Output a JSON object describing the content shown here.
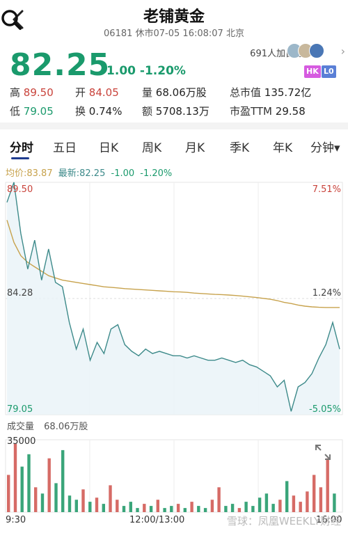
{
  "header": {
    "title": "老铺黄金",
    "subtitle": "06181 休市07-05 16:08:07 北京"
  },
  "quote": {
    "price": "82.25",
    "change": "-1.00 -1.20%",
    "watchers": "691人加自选",
    "tags": [
      "HK",
      "L0"
    ],
    "colors": {
      "down": "#1a9a6c",
      "up": "#c9433b",
      "hk": "#d65be0",
      "lo": "#5a7fd6"
    }
  },
  "stats": {
    "high_label": "高",
    "high": "89.50",
    "open_label": "开",
    "open": "84.05",
    "volume_label": "量",
    "volume": "68.06万股",
    "mcap_label": "总市值",
    "mcap": "135.72亿",
    "low_label": "低",
    "low": "79.05",
    "turnover_label": "换",
    "turnover": "0.74%",
    "amount_label": "额",
    "amount": "5708.13万",
    "pe_label": "市盈TTM",
    "pe": "29.58"
  },
  "tabs": [
    "分时",
    "五日",
    "日K",
    "周K",
    "月K",
    "季K",
    "年K",
    "分钟▾"
  ],
  "legend": {
    "avg": "均价:83.87",
    "latest": "最新:82.25",
    "chg": "-1.00",
    "pct": "-1.20%"
  },
  "chart_data": {
    "type": "line",
    "y_left_ticks": [
      "89.50",
      "84.28",
      "79.05"
    ],
    "y_right_ticks": [
      "7.51%",
      "1.24%",
      "-5.05%"
    ],
    "ylim": [
      79.05,
      89.5
    ],
    "x_ticks": [
      "9:30",
      "12:00/13:00",
      "16:00"
    ],
    "series": [
      {
        "name": "price",
        "color": "#3d8a8a",
        "values": [
          88.6,
          89.5,
          87.2,
          85.6,
          86.9,
          85.1,
          86.5,
          85.0,
          84.8,
          83.2,
          82.0,
          82.9,
          81.5,
          82.3,
          81.8,
          82.9,
          83.1,
          82.2,
          81.9,
          81.7,
          82.0,
          81.8,
          81.9,
          81.8,
          81.7,
          81.7,
          81.6,
          81.7,
          81.6,
          81.5,
          81.5,
          81.6,
          81.5,
          81.4,
          81.5,
          81.3,
          81.2,
          81.0,
          80.8,
          80.3,
          80.6,
          79.2,
          80.3,
          80.5,
          80.9,
          81.6,
          82.2,
          83.2,
          82.0
        ]
      },
      {
        "name": "avg",
        "color": "#c7a24c",
        "values": [
          87.8,
          86.8,
          86.2,
          85.9,
          85.7,
          85.5,
          85.3,
          85.2,
          85.1,
          85.05,
          85.0,
          84.95,
          84.9,
          84.85,
          84.8,
          84.78,
          84.75,
          84.72,
          84.7,
          84.68,
          84.66,
          84.64,
          84.62,
          84.6,
          84.58,
          84.57,
          84.55,
          84.52,
          84.5,
          84.48,
          84.46,
          84.45,
          84.43,
          84.41,
          84.38,
          84.35,
          84.32,
          84.28,
          84.24,
          84.18,
          84.1,
          84.05,
          83.98,
          83.93,
          83.9,
          83.88,
          83.87,
          83.87,
          83.87
        ]
      }
    ],
    "volume_label": "成交量",
    "volume_value": "68.06万股",
    "volume_max_tick": "35000",
    "volume_ylim": [
      0,
      35000
    ],
    "volumes": [
      18000,
      33000,
      22000,
      28000,
      12000,
      9000,
      26000,
      14000,
      30000,
      8000,
      6000,
      11000,
      5000,
      7000,
      4000,
      13000,
      6000,
      3000,
      5000,
      2000,
      4000,
      3000,
      6000,
      2000,
      3000,
      4000,
      2000,
      5000,
      3000,
      2000,
      6000,
      12000,
      3000,
      4000,
      2000,
      5000,
      3000,
      7000,
      9000,
      4000,
      6000,
      15000,
      8000,
      5000,
      10000,
      18000,
      12000,
      26000,
      9000
    ]
  },
  "watermark": "雪球：凤凰WEEKLY财经"
}
